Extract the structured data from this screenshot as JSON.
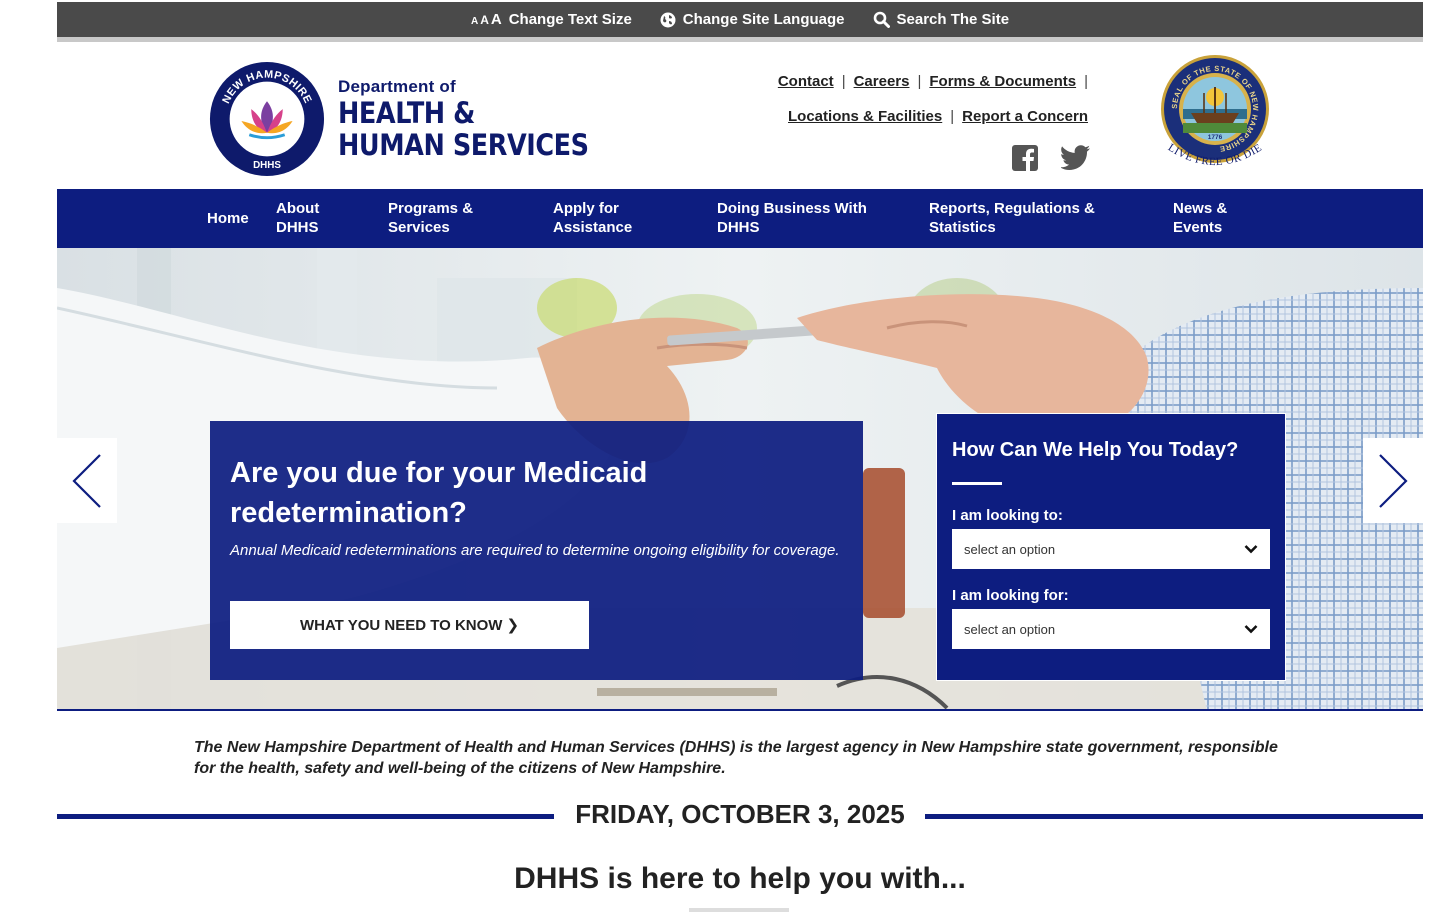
{
  "utility": {
    "text_size_glyphs": [
      "A",
      "A",
      "A"
    ],
    "text_size_label": "Change Text Size",
    "language_label": "Change Site Language",
    "search_label": "Search The Site"
  },
  "logo": {
    "ring_top": "NEW HAMPSHIRE",
    "ring_bottom": "DHHS",
    "dept": "Department of",
    "line1": "HEALTH &",
    "line2": "HUMAN SERVICES"
  },
  "header_links": {
    "row1": [
      "Contact",
      "Careers",
      "Forms & Documents"
    ],
    "row2": [
      "Locations & Facilities",
      "Report a Concern"
    ],
    "separator": "|"
  },
  "seal": {
    "ring_text": "SEAL OF THE STATE OF NEW HAMPSHIRE",
    "year": "1776",
    "motto": "LIVE FREE OR DIE"
  },
  "nav": [
    {
      "line1": "Home",
      "line2": ""
    },
    {
      "line1": "About",
      "line2": "DHHS"
    },
    {
      "line1": "Programs &",
      "line2": "Services"
    },
    {
      "line1": "Apply for",
      "line2": "Assistance"
    },
    {
      "line1": "Doing Business With",
      "line2": "DHHS"
    },
    {
      "line1": "Reports, Regulations &",
      "line2": "Statistics"
    },
    {
      "line1": "News &",
      "line2": "Events"
    }
  ],
  "promo": {
    "title_line1": "Are you due for your Medicaid",
    "title_line2": "redetermination?",
    "body": "Annual Medicaid redeterminations are required to determine ongoing eligibility for coverage.",
    "button_label": "WHAT YOU NEED TO KNOW",
    "button_glyph": "❯"
  },
  "help": {
    "title": "How Can We Help You Today?",
    "label1": "I am looking to:",
    "select1": "select an option",
    "label2": "I am looking for:",
    "select2": "select an option"
  },
  "intro": "The New Hampshire Department of Health and Human Services (DHHS) is the largest agency in New Hampshire state government, responsible for the health, safety and well-being of the citizens of New Hampshire.",
  "date": "FRIDAY, OCTOBER 3, 2025",
  "help_heading": "DHHS is here to help you with...",
  "colors": {
    "brand_navy": "#0d1d80",
    "utility_bar": "#4a4a4a",
    "white": "#ffffff"
  },
  "icons": [
    "text-size-icon",
    "globe-icon",
    "search-icon",
    "facebook-icon",
    "twitter-icon",
    "chevron-down-icon",
    "chevron-left-icon",
    "chevron-right-icon"
  ]
}
